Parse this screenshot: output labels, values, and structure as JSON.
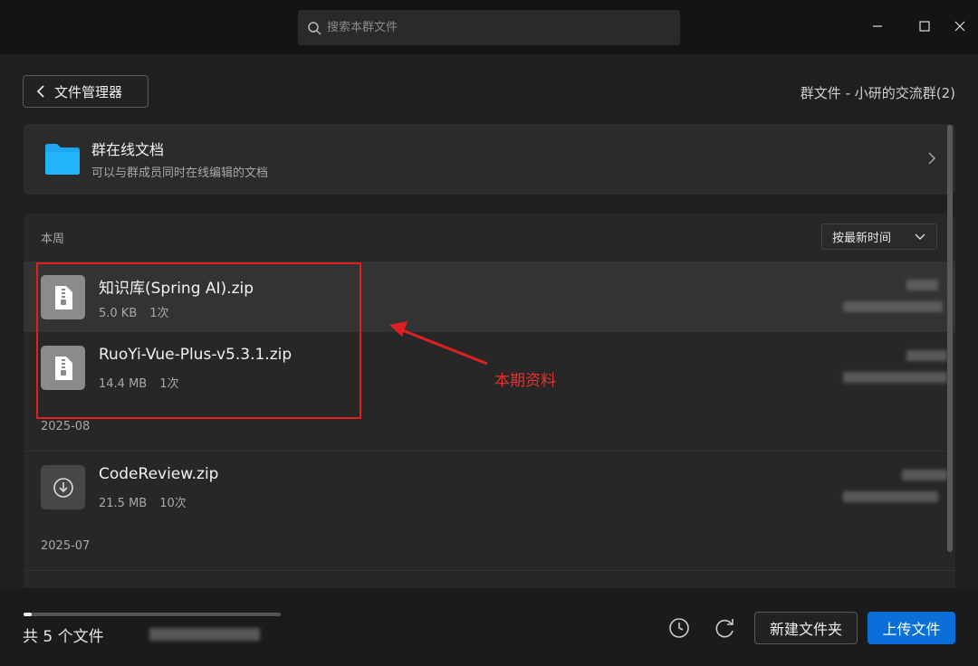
{
  "search": {
    "placeholder": "搜索本群文件",
    "icon": "search-icon"
  },
  "window_controls": {
    "icons": [
      "minimize-icon",
      "maximize-icon",
      "close-icon"
    ]
  },
  "header": {
    "back_label": "文件管理器",
    "group_title": "群文件 - 小研的交流群(2)"
  },
  "online_doc": {
    "title": "群在线文档",
    "subtitle": "可以与群成员同时在线编辑的文档"
  },
  "sort": {
    "label": "按最新时间"
  },
  "sections": [
    {
      "label": "本周"
    },
    {
      "label": "2025-08"
    },
    {
      "label": "2025-07"
    }
  ],
  "files": [
    {
      "name": "知识库(Spring AI).zip",
      "size": "5.0 KB",
      "downloads": "1次",
      "icon": "zip-file-icon"
    },
    {
      "name": "RuoYi-Vue-Plus-v5.3.1.zip",
      "size": "14.4 MB",
      "downloads": "1次",
      "icon": "zip-file-icon"
    },
    {
      "name": "CodeReview.zip",
      "size": "21.5 MB",
      "downloads": "10次",
      "icon": "download-icon"
    }
  ],
  "annotation": {
    "text": "本期资料",
    "color": "#e02020"
  },
  "footer": {
    "file_count": "共 5 个文件",
    "storage_progress": 0.03,
    "new_folder_label": "新建文件夹",
    "upload_label": "上传文件"
  },
  "colors": {
    "accent": "#0a6fd8",
    "background": "#1f1f1f",
    "folder": "#1ea7f0"
  }
}
